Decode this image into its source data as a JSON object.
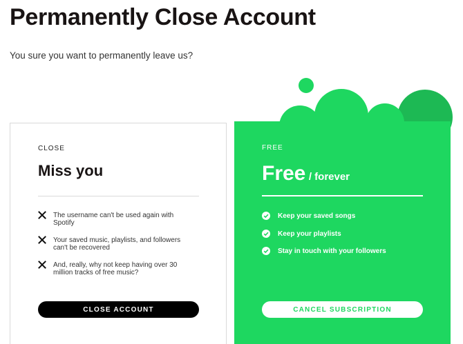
{
  "header": {
    "title": "Permanently Close Account",
    "subtitle": "You sure you want to permanently leave us?"
  },
  "close_card": {
    "label": "CLOSE",
    "heading": "Miss you",
    "items": [
      {
        "icon": "x-icon",
        "line1": "The username can't be used again with",
        "line2": "Spotify"
      },
      {
        "icon": "x-icon",
        "line1": "Your saved music, playlists, and followers",
        "line2": "can't be recovered"
      },
      {
        "icon": "x-icon",
        "line1": "And, really, why not keep having over 30",
        "line2": "million tracks of free music?"
      }
    ],
    "button_label": "CLOSE ACCOUNT"
  },
  "free_card": {
    "label": "FREE",
    "heading": "Free",
    "heading_suffix": "/ forever",
    "items": [
      {
        "icon": "check-circle-icon",
        "text": "Keep your saved songs"
      },
      {
        "icon": "check-circle-icon",
        "text": "Keep your playlists"
      },
      {
        "icon": "check-circle-icon",
        "text": "Stay in touch with your followers"
      }
    ],
    "button_label": "CANCEL SUBSCRIPTION"
  },
  "colors": {
    "brand_green": "#1ed760",
    "dark_green_blob": "#1db954",
    "black": "#000000"
  }
}
